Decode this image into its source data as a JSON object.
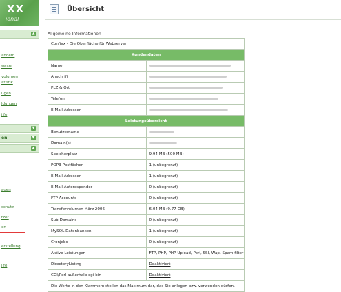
{
  "sidebar": {
    "logo": {
      "brand": "XX",
      "subtitle": "ional"
    },
    "sections": [
      {
        "label": ""
      },
      {
        "label": ""
      },
      {
        "label": "en"
      },
      {
        "label": ""
      }
    ],
    "items": [
      "ändern",
      "swahl",
      "volumen",
      "atistik",
      "ugen",
      "ldungen",
      "ilfe",
      "agen",
      "schutz",
      "tzer",
      "en",
      "",
      "erstellung",
      "ilfe"
    ]
  },
  "header": {
    "title": "Übersicht"
  },
  "fieldset": {
    "legend": "Allgemeine Informationen"
  },
  "table": {
    "title": "Confixx - Die Oberfläche für Webserver",
    "customer_header": "Kundendaten",
    "customer_rows": [
      "Name",
      "Anschrift",
      "PLZ & Ort",
      "Telefon",
      "E-Mail Adressen"
    ],
    "services_header": "Leistungsübersicht",
    "service_rows": [
      {
        "label": "Benutzername",
        "value": ""
      },
      {
        "label": "Domain(s)",
        "value": ""
      },
      {
        "label": "Speicherplatz",
        "value": "9.94 MB (500 MB)"
      },
      {
        "label": "POP3-Postfächer",
        "value": "1 (unbegrenzt)"
      },
      {
        "label": "E-Mail Adressen",
        "value": "1 (unbegrenzt)"
      },
      {
        "label": "E-Mail Autoresponder",
        "value": "0 (unbegrenzt)"
      },
      {
        "label": "FTP-Accounts",
        "value": "0 (unbegrenzt)"
      },
      {
        "label": "Transfervolumen März 2006",
        "value": "6.04 MB (9.77 GB)"
      },
      {
        "label": "Sub-Domains",
        "value": "0 (unbegrenzt)"
      },
      {
        "label": "MySQL-Datenbanken",
        "value": "1 (unbegrenzt)"
      },
      {
        "label": "Cronjobs",
        "value": "0 (unbegrenzt)"
      },
      {
        "label": "Aktive Leistungen",
        "value": "FTP, PHP, PHP-Upload, Perl, SSI, Wap, Spam filter"
      },
      {
        "label": "DirectoryListing",
        "value": "Deaktiviert"
      },
      {
        "label": "CGI/Perl außerhalb cgi-bin",
        "value": "Deaktiviert"
      }
    ],
    "footer_note": "Die Werte in den Klammern stellen das Maximum dar, das Sie anlegen bzw. verwenden dürfen."
  }
}
